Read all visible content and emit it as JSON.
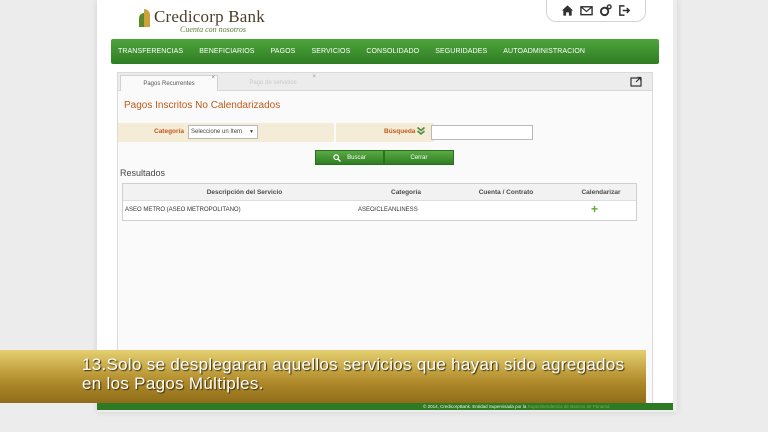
{
  "header": {
    "brand_name": "Credicorp Bank",
    "brand_tagline": "Cuenta con nosotros",
    "icons": [
      "home-icon",
      "mail-icon",
      "settings-icon",
      "logout-icon"
    ]
  },
  "nav": {
    "items": [
      "TRANSFERENCIAS",
      "BENEFICIARIOS",
      "PAGOS",
      "SERVICIOS",
      "CONSOLIDADO",
      "SEGURIDADES",
      "AUTOADMINISTRACION"
    ]
  },
  "tabs": [
    {
      "label": "Pagos Recurrentes",
      "close": "×",
      "active": true
    },
    {
      "label": "Pago de servicios",
      "close": "×",
      "active": false
    }
  ],
  "main": {
    "title": "Pagos Inscritos No Calendarizados",
    "filter": {
      "category_label": "Categoría",
      "category_value": "Seleccione un Item",
      "search_label": "Búsqueda"
    },
    "buttons": {
      "search": "Buscar",
      "close": "Cerrar"
    },
    "results_label": "Resultados",
    "table": {
      "columns": [
        "Descripción del Servicio",
        "Categoría",
        "Cuenta / Contrato",
        "Calendarizar"
      ],
      "rows": [
        {
          "description": "ASEO METRO (ASEO METROPOLITANO)",
          "category": "ASEO/CLEANLINESS",
          "account": "",
          "action": "+"
        }
      ]
    }
  },
  "footer": {
    "text": "© 2014, CredicorpBank. Entidad Supervisada por la",
    "link": "Superintendencia de Bancos de Panamá"
  },
  "caption": {
    "line1": "13.Solo se desplegaran aquellos servicios que hayan sido agregados",
    "line2": "en los Pagos Múltiples."
  },
  "colors": {
    "nav_green": "#2f7d24",
    "title_orange": "#c05a1b",
    "caption_gold": "#b08a2a"
  }
}
